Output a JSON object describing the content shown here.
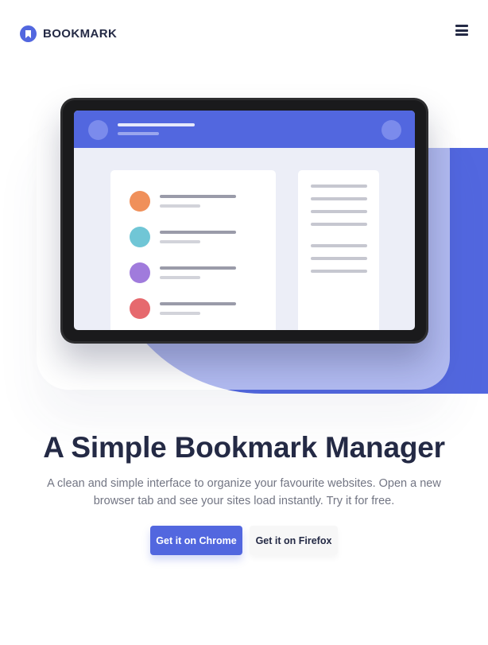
{
  "header": {
    "logo_text": "BOOKMARK",
    "menu_icon": "hamburger-menu-icon"
  },
  "hero": {
    "title": "A Simple Bookmark Manager",
    "description": "A clean and simple interface to organize your favourite websites. Open a new browser tab and see your sites load instantly. Try it for free.",
    "primary_button": "Get it on Chrome",
    "secondary_button": "Get it on Firefox"
  },
  "illustration": {
    "bookmark_colors": [
      "#f0905a",
      "#70c6d6",
      "#a07bdc",
      "#e6696e"
    ]
  },
  "colors": {
    "accent": "#5267df",
    "heading": "#242a45",
    "body_text": "#727583"
  }
}
